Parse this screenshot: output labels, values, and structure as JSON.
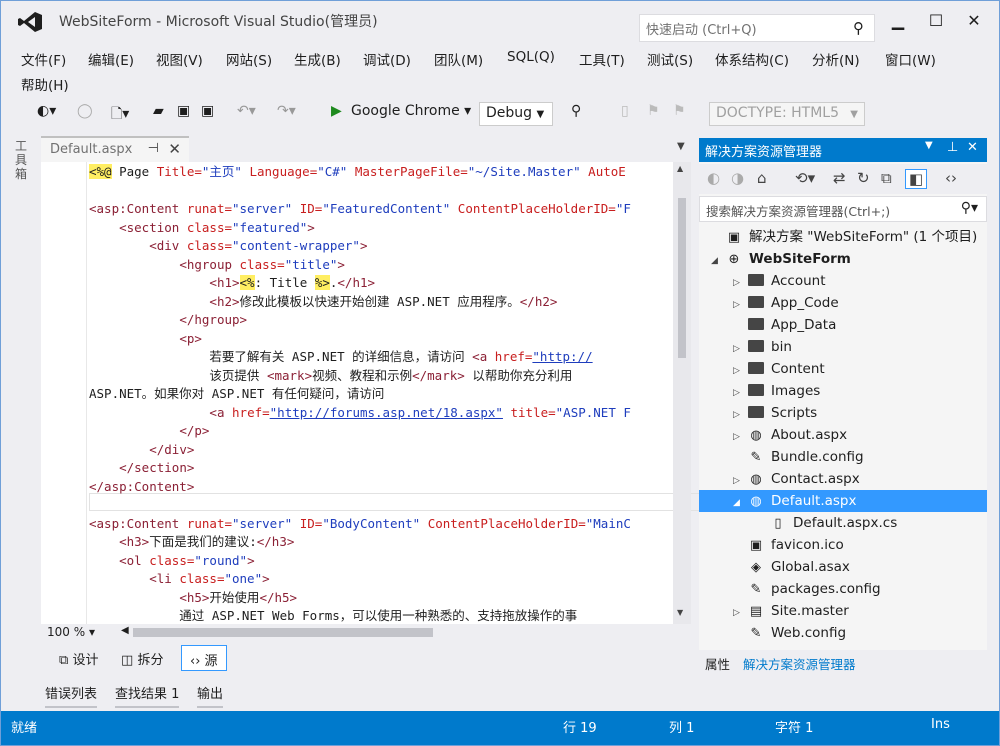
{
  "window": {
    "title": "WebSiteForm - Microsoft Visual Studio(管理员)",
    "quick_launch_placeholder": "快速启动 (Ctrl+Q)"
  },
  "menu": [
    "文件(F)",
    "编辑(E)",
    "视图(V)",
    "网站(S)",
    "生成(B)",
    "调试(D)",
    "团队(M)",
    "SQL(Q)",
    "工具(T)",
    "测试(S)",
    "体系结构(C)",
    "分析(N)",
    "窗口(W)",
    "帮助(H)"
  ],
  "toolbar": {
    "run_target": "Google Chrome",
    "configuration": "Debug",
    "doctype": "DOCTYPE:  HTML5"
  },
  "left_strip": {
    "label": "工具箱"
  },
  "document_tab": {
    "label": "Default.aspx"
  },
  "editor": {
    "zoom": "100 %",
    "lines": [
      [
        [
          "aspx",
          "<%@"
        ],
        [
          "txt",
          " Page "
        ],
        [
          "attr",
          "Title="
        ],
        [
          "val",
          "\"主页\""
        ],
        [
          "txt",
          " "
        ],
        [
          "attr",
          "Language="
        ],
        [
          "val",
          "\"C#\""
        ],
        [
          "txt",
          " "
        ],
        [
          "attr",
          "MasterPageFile="
        ],
        [
          "val",
          "\"~/Site.Master\""
        ],
        [
          "txt",
          " "
        ],
        [
          "attr",
          "AutoE"
        ]
      ],
      [],
      [
        [
          "tag",
          "<asp:Content"
        ],
        [
          "txt",
          " "
        ],
        [
          "attr",
          "runat="
        ],
        [
          "val",
          "\"server\""
        ],
        [
          "txt",
          " "
        ],
        [
          "attr",
          "ID="
        ],
        [
          "val",
          "\"FeaturedContent\""
        ],
        [
          "txt",
          " "
        ],
        [
          "attr",
          "ContentPlaceHolderID="
        ],
        [
          "val",
          "\"F"
        ]
      ],
      [
        [
          "txt",
          "    "
        ],
        [
          "tag",
          "<section"
        ],
        [
          "txt",
          " "
        ],
        [
          "attr",
          "class="
        ],
        [
          "val",
          "\"featured\""
        ],
        [
          "tag",
          ">"
        ]
      ],
      [
        [
          "txt",
          "        "
        ],
        [
          "tag",
          "<div"
        ],
        [
          "txt",
          " "
        ],
        [
          "attr",
          "class="
        ],
        [
          "val",
          "\"content-wrapper\""
        ],
        [
          "tag",
          ">"
        ]
      ],
      [
        [
          "txt",
          "            "
        ],
        [
          "tag",
          "<hgroup"
        ],
        [
          "txt",
          " "
        ],
        [
          "attr",
          "class="
        ],
        [
          "val",
          "\"title\""
        ],
        [
          "tag",
          ">"
        ]
      ],
      [
        [
          "txt",
          "                "
        ],
        [
          "tag",
          "<h1>"
        ],
        [
          "aspx",
          "<%"
        ],
        [
          "txt",
          ": Title "
        ],
        [
          "aspx",
          "%>"
        ],
        [
          "txt",
          "."
        ],
        [
          "tag",
          "</h1>"
        ]
      ],
      [
        [
          "txt",
          "                "
        ],
        [
          "tag",
          "<h2>"
        ],
        [
          "txt",
          "修改此模板以快速开始创建 ASP.NET 应用程序。"
        ],
        [
          "tag",
          "</h2>"
        ]
      ],
      [
        [
          "txt",
          "            "
        ],
        [
          "tag",
          "</hgroup>"
        ]
      ],
      [
        [
          "txt",
          "            "
        ],
        [
          "tag",
          "<p>"
        ]
      ],
      [
        [
          "txt",
          "                若要了解有关 ASP.NET 的详细信息，请访问 "
        ],
        [
          "tag",
          "<a"
        ],
        [
          "txt",
          " "
        ],
        [
          "attr",
          "href="
        ],
        [
          "url",
          "\"http://"
        ]
      ],
      [
        [
          "txt",
          "                该页提供 "
        ],
        [
          "tag",
          "<mark>"
        ],
        [
          "txt",
          "视频、教程和示例"
        ],
        [
          "tag",
          "</mark>"
        ],
        [
          "txt",
          " 以帮助你充分利用"
        ]
      ],
      [
        [
          "txt",
          "ASP.NET。如果你对 ASP.NET 有任何疑问，请访问"
        ]
      ],
      [
        [
          "txt",
          "                "
        ],
        [
          "tag",
          "<a"
        ],
        [
          "txt",
          " "
        ],
        [
          "attr",
          "href="
        ],
        [
          "url",
          "\"http://forums.asp.net/18.aspx\""
        ],
        [
          "txt",
          " "
        ],
        [
          "attr",
          "title="
        ],
        [
          "val",
          "\"ASP.NET F"
        ]
      ],
      [
        [
          "txt",
          "            "
        ],
        [
          "tag",
          "</p>"
        ]
      ],
      [
        [
          "txt",
          "        "
        ],
        [
          "tag",
          "</div>"
        ]
      ],
      [
        [
          "txt",
          "    "
        ],
        [
          "tag",
          "</section>"
        ]
      ],
      [
        [
          "tag",
          "</asp:Content>"
        ]
      ],
      [],
      [
        [
          "tag",
          "<asp:Content"
        ],
        [
          "txt",
          " "
        ],
        [
          "attr",
          "runat="
        ],
        [
          "val",
          "\"server\""
        ],
        [
          "txt",
          " "
        ],
        [
          "attr",
          "ID="
        ],
        [
          "val",
          "\"BodyContent\""
        ],
        [
          "txt",
          " "
        ],
        [
          "attr",
          "ContentPlaceHolderID="
        ],
        [
          "val",
          "\"MainC"
        ]
      ],
      [
        [
          "txt",
          "    "
        ],
        [
          "tag",
          "<h3>"
        ],
        [
          "txt",
          "下面是我们的建议:"
        ],
        [
          "tag",
          "</h3>"
        ]
      ],
      [
        [
          "txt",
          "    "
        ],
        [
          "tag",
          "<ol"
        ],
        [
          "txt",
          " "
        ],
        [
          "attr",
          "class="
        ],
        [
          "val",
          "\"round\""
        ],
        [
          "tag",
          ">"
        ]
      ],
      [
        [
          "txt",
          "        "
        ],
        [
          "tag",
          "<li"
        ],
        [
          "txt",
          " "
        ],
        [
          "attr",
          "class="
        ],
        [
          "val",
          "\"one\""
        ],
        [
          "tag",
          ">"
        ]
      ],
      [
        [
          "txt",
          "            "
        ],
        [
          "tag",
          "<h5>"
        ],
        [
          "txt",
          "开始使用"
        ],
        [
          "tag",
          "</h5>"
        ]
      ],
      [
        [
          "txt",
          "            通过 ASP.NET Web Forms，可以使用一种熟悉的、支持拖放操作的事"
        ]
      ]
    ]
  },
  "view_tabs": [
    {
      "icon": "design-icon",
      "label": "设计"
    },
    {
      "icon": "split-icon",
      "label": "拆分"
    },
    {
      "icon": "source-icon",
      "label": "源"
    }
  ],
  "bottom_tabs": [
    "错误列表",
    "查找结果 1",
    "输出"
  ],
  "solution_explorer": {
    "title": "解决方案资源管理器",
    "search_placeholder": "搜索解决方案资源管理器(Ctrl+;)",
    "tree": [
      {
        "label": "解决方案 \"WebSiteForm\" (1 个项目)",
        "icon": "solution-icon",
        "arrow": "",
        "depth": 0
      },
      {
        "label": "WebSiteForm",
        "icon": "web-project-icon",
        "arrow": "open",
        "depth": 0,
        "bold": true
      },
      {
        "label": "Account",
        "icon": "folder-icon",
        "arrow": "closed",
        "depth": 1
      },
      {
        "label": "App_Code",
        "icon": "folder-icon",
        "arrow": "closed",
        "depth": 1
      },
      {
        "label": "App_Data",
        "icon": "folder-icon",
        "arrow": "",
        "depth": 1
      },
      {
        "label": "bin",
        "icon": "folder-icon",
        "arrow": "closed",
        "depth": 1
      },
      {
        "label": "Content",
        "icon": "folder-icon",
        "arrow": "closed",
        "depth": 1
      },
      {
        "label": "Images",
        "icon": "folder-icon",
        "arrow": "closed",
        "depth": 1
      },
      {
        "label": "Scripts",
        "icon": "folder-icon",
        "arrow": "closed",
        "depth": 1
      },
      {
        "label": "About.aspx",
        "icon": "aspx-icon",
        "arrow": "closed",
        "depth": 1
      },
      {
        "label": "Bundle.config",
        "icon": "config-icon",
        "arrow": "",
        "depth": 1
      },
      {
        "label": "Contact.aspx",
        "icon": "aspx-icon",
        "arrow": "closed",
        "depth": 1
      },
      {
        "label": "Default.aspx",
        "icon": "aspx-icon",
        "arrow": "open",
        "depth": 1,
        "selected": true
      },
      {
        "label": "Default.aspx.cs",
        "icon": "cs-icon",
        "arrow": "",
        "depth": 2
      },
      {
        "label": "favicon.ico",
        "icon": "ico-icon",
        "arrow": "",
        "depth": 1
      },
      {
        "label": "Global.asax",
        "icon": "asax-icon",
        "arrow": "",
        "depth": 1
      },
      {
        "label": "packages.config",
        "icon": "config-icon",
        "arrow": "",
        "depth": 1
      },
      {
        "label": "Site.master",
        "icon": "master-icon",
        "arrow": "closed",
        "depth": 1
      },
      {
        "label": "Web.config",
        "icon": "config-icon",
        "arrow": "",
        "depth": 1
      }
    ],
    "tabs": [
      "属性",
      "解决方案资源管理器"
    ]
  },
  "status": {
    "state": "就绪",
    "line": "行 19",
    "col": "列 1",
    "char": "字符 1",
    "mode": "Ins"
  },
  "colors": {
    "accent": "#007acc",
    "selection": "#3399ff",
    "tag": "#8b2035",
    "attr": "#c81e1e",
    "value": "#1e3dbd"
  }
}
